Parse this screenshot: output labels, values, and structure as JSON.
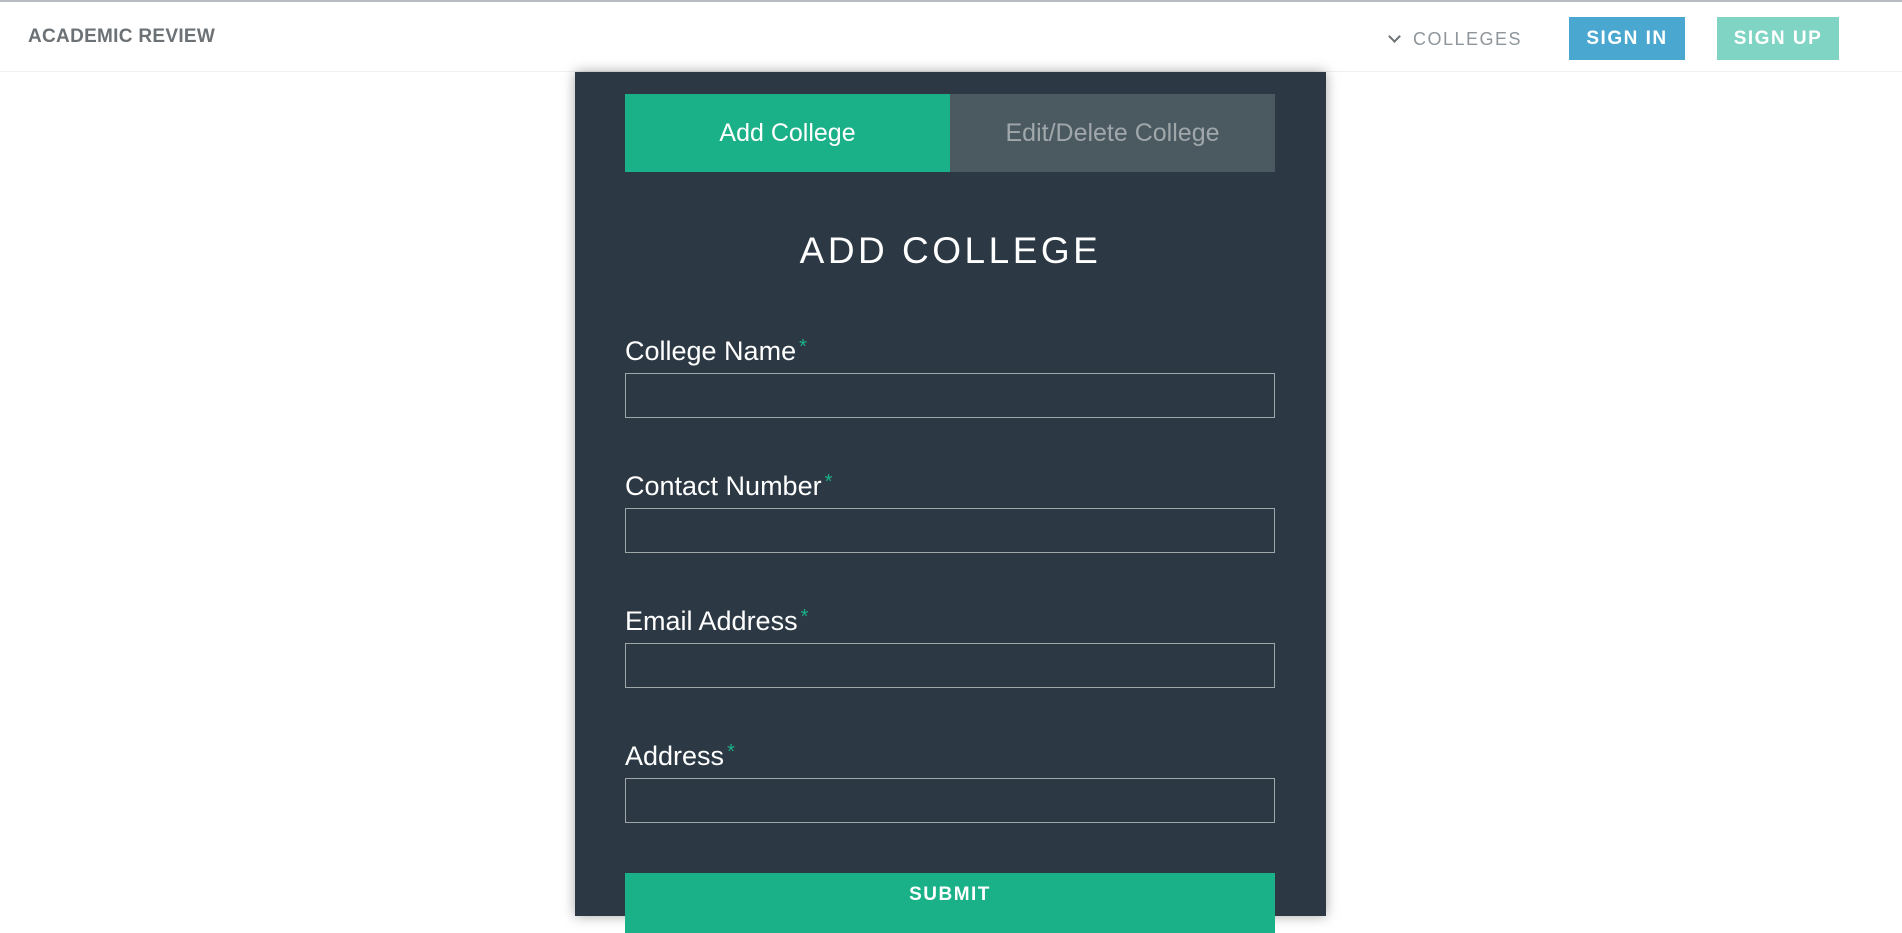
{
  "header": {
    "brand": "ACADEMIC REVIEW",
    "nav_colleges": "COLLEGES",
    "sign_in": "SIGN IN",
    "sign_up": "SIGN UP"
  },
  "tabs": {
    "add": "Add College",
    "edit": "Edit/Delete College"
  },
  "form": {
    "title": "ADD COLLEGE",
    "required_mark": "*",
    "fields": [
      {
        "label": "College Name",
        "value": ""
      },
      {
        "label": "Contact Number",
        "value": ""
      },
      {
        "label": "Email Address",
        "value": ""
      },
      {
        "label": "Address",
        "value": ""
      }
    ],
    "submit": "SUBMIT"
  },
  "colors": {
    "panel_bg": "#2c3944",
    "accent": "#1ab188",
    "signin_bg": "#4aa8d0",
    "signup_bg": "#7fd4c4",
    "inactive_tab": "#4b5a61"
  },
  "icons": {
    "nav_colleges": "chevron-down-icon"
  }
}
